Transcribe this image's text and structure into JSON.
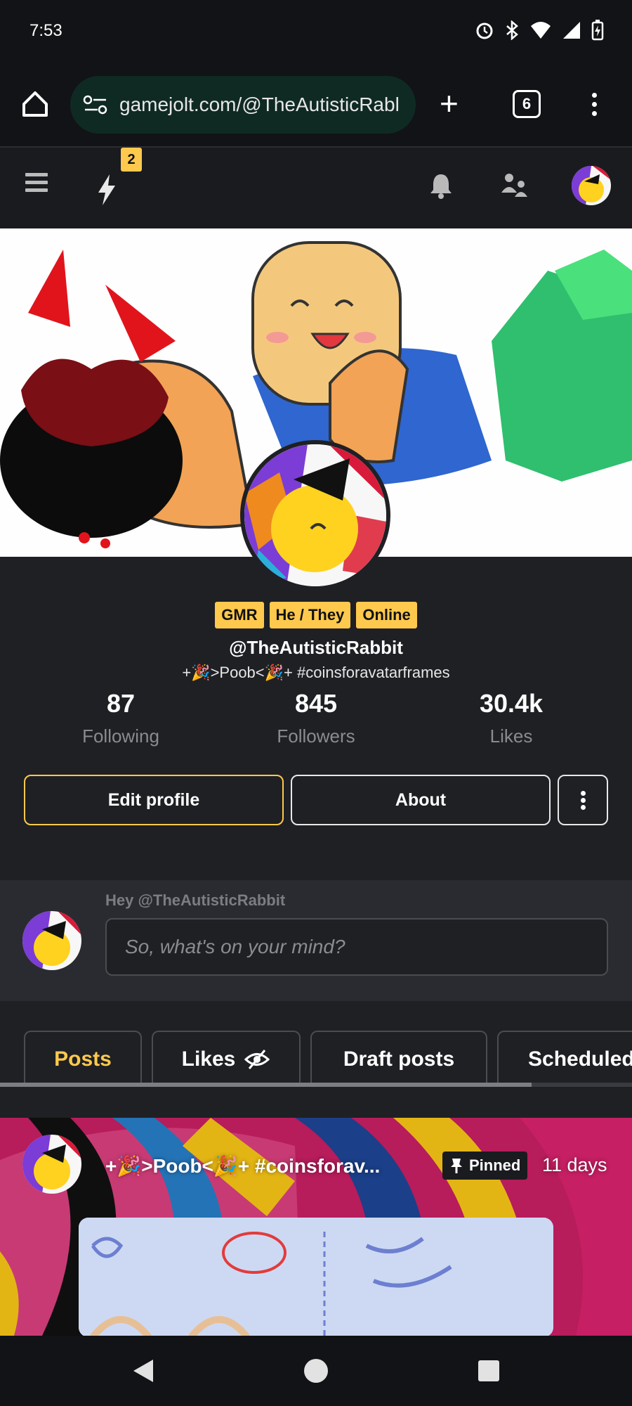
{
  "status_bar": {
    "time": "7:53",
    "icons": [
      "alarm-icon",
      "bluetooth-icon",
      "wifi-icon",
      "signal-icon",
      "battery-charging-icon"
    ]
  },
  "browser": {
    "url": "gamejolt.com/@TheAutisticRabl",
    "tab_count": "6"
  },
  "top_nav": {
    "notification_count": "2"
  },
  "profile": {
    "tags": [
      "GMR",
      "He / They",
      "Online"
    ],
    "username": "@TheAutisticRabbit",
    "bio": "+🎉>Poob<🎉+ #coinsforavatarframes",
    "stats": [
      {
        "value": "87",
        "label": "Following"
      },
      {
        "value": "845",
        "label": "Followers"
      },
      {
        "value": "30.4k",
        "label": "Likes"
      }
    ],
    "buttons": {
      "edit": "Edit profile",
      "about": "About"
    }
  },
  "composer": {
    "greeting": "Hey @TheAutisticRabbit",
    "placeholder": "So, what's on your mind?"
  },
  "tabs": [
    {
      "label": "Posts"
    },
    {
      "label": "Likes"
    },
    {
      "label": "Draft posts"
    },
    {
      "label": "Scheduled"
    }
  ],
  "post": {
    "title": "+🎉>Poob<🎉+ #coinsforav...",
    "pinned_label": "Pinned",
    "age": "11 days"
  },
  "colors": {
    "accent": "#ffc94d",
    "background": "#1f2024"
  }
}
